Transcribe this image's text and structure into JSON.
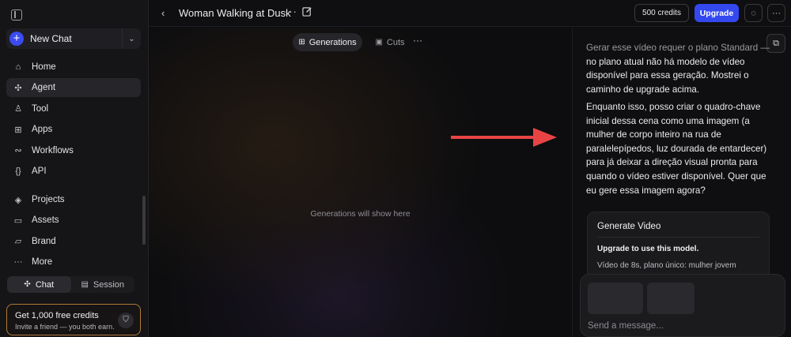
{
  "sidebar": {
    "new_chat": "New Chat",
    "items_top": [
      {
        "label": "Home",
        "icon": "home-icon"
      },
      {
        "label": "Agent",
        "icon": "sparkle-icon",
        "active": true
      },
      {
        "label": "Tool",
        "icon": "user-icon"
      },
      {
        "label": "Apps",
        "icon": "grid-icon"
      },
      {
        "label": "Workflows",
        "icon": "workflow-icon"
      },
      {
        "label": "API",
        "icon": "braces-icon"
      }
    ],
    "items_bottom": [
      {
        "label": "Projects",
        "icon": "layers-icon"
      },
      {
        "label": "Assets",
        "icon": "folder-icon"
      },
      {
        "label": "Brand",
        "icon": "brand-icon"
      },
      {
        "label": "More",
        "icon": "more-icon"
      }
    ],
    "segment": {
      "chat": "Chat",
      "session": "Session"
    },
    "promo": {
      "title": "Get 1,000 free credits",
      "subtitle": "Invite a friend — you both earn."
    }
  },
  "header": {
    "title": "Woman Walking at Dusk",
    "credits": "500 credits",
    "upgrade": "Upgrade"
  },
  "canvas": {
    "tab_generations": "Generations",
    "tab_cuts": "Cuts",
    "empty_text": "Generations will show here"
  },
  "chat": {
    "message1_faded": "Gerar esse vídeo requer o plano Standard —",
    "message1_rest": "no plano atual não há modelo de vídeo disponível para essa geração. Mostrei o caminho de upgrade acima.",
    "message2": "Enquanto isso, posso criar o quadro-chave inicial dessa cena como uma imagem (a mulher de corpo inteiro na rua de paralelepípedos, luz dourada de entardecer) para já deixar a direção visual pronta para quando o vídeo estiver disponível. Quer que eu gere essa imagem agora?",
    "card": {
      "title": "Generate Video",
      "upgrade_note": "Upgrade to use this model.",
      "description": "Vídeo de 8s, plano único: mulher jovem"
    },
    "composer_placeholder": "Send a message..."
  },
  "colors": {
    "accent": "#3448f0",
    "promo_border": "#b07a3a",
    "arrow": "#e84444"
  }
}
